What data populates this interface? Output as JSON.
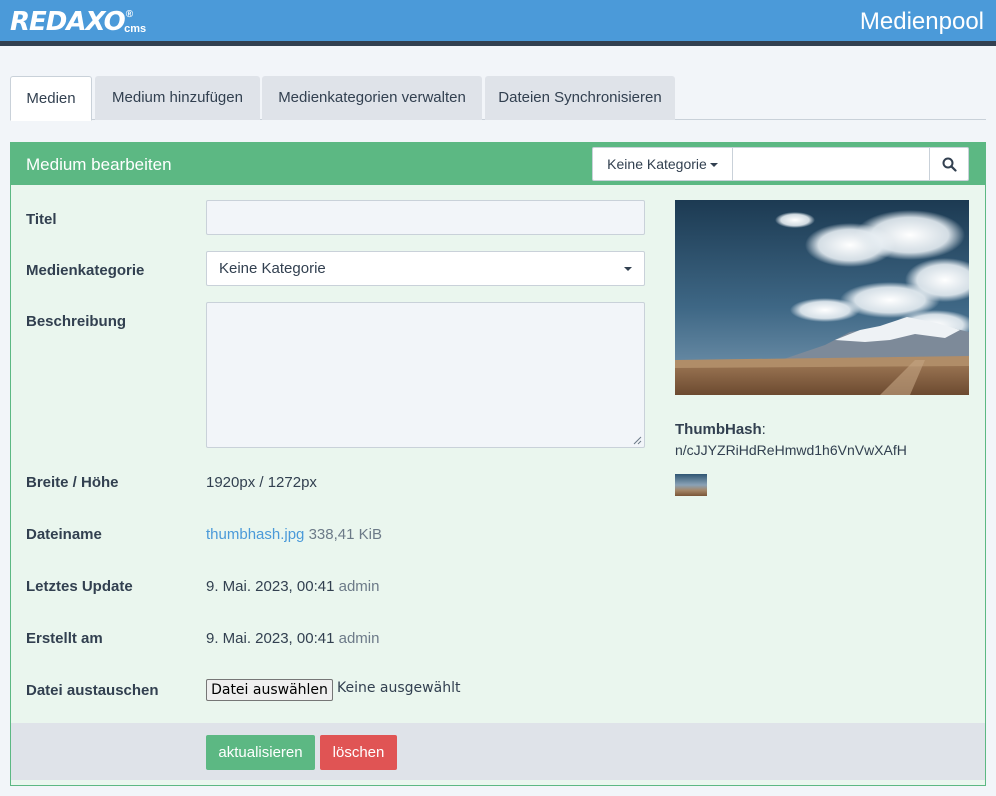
{
  "header": {
    "logo_text": "REDAXO",
    "logo_reg": "®",
    "logo_cms": "cms",
    "page_title": "Medienpool"
  },
  "tabs": [
    {
      "label": "Medien",
      "active": true
    },
    {
      "label": "Medium hinzufügen",
      "active": false
    },
    {
      "label": "Medienkategorien verwalten",
      "active": false
    },
    {
      "label": "Dateien Synchronisieren",
      "active": false
    }
  ],
  "panel": {
    "title": "Medium bearbeiten",
    "filter_category": "Keine Kategorie",
    "search_value": ""
  },
  "form": {
    "title_label": "Titel",
    "title_value": "",
    "category_label": "Medienkategorie",
    "category_value": "Keine Kategorie",
    "description_label": "Beschreibung",
    "description_value": "",
    "size_label": "Breite / Höhe",
    "size_value": "1920px / 1272px",
    "filename_label": "Dateiname",
    "filename_link": "thumbhash.jpg",
    "filesize": "338,41 KiB",
    "updated_label": "Letztes Update",
    "updated_date": "9. Mai. 2023, 00:41",
    "updated_user": "admin",
    "created_label": "Erstellt am",
    "created_date": "9. Mai. 2023, 00:41",
    "created_user": "admin",
    "replace_label": "Datei austauschen",
    "file_button": "Datei auswählen",
    "file_status": "Keine ausgewählt"
  },
  "thumbhash": {
    "label": "ThumbHash",
    "colon": ":",
    "value": "n/cJJYZRiHdReHmwd1h6VnVwXAfH"
  },
  "actions": {
    "save": "aktualisieren",
    "delete": "löschen"
  },
  "colors": {
    "brand_blue": "#4b9ad9",
    "panel_green": "#5cb883",
    "panel_bg": "#eaf6ee",
    "danger_red": "#e05454",
    "text_dark": "#324050"
  }
}
